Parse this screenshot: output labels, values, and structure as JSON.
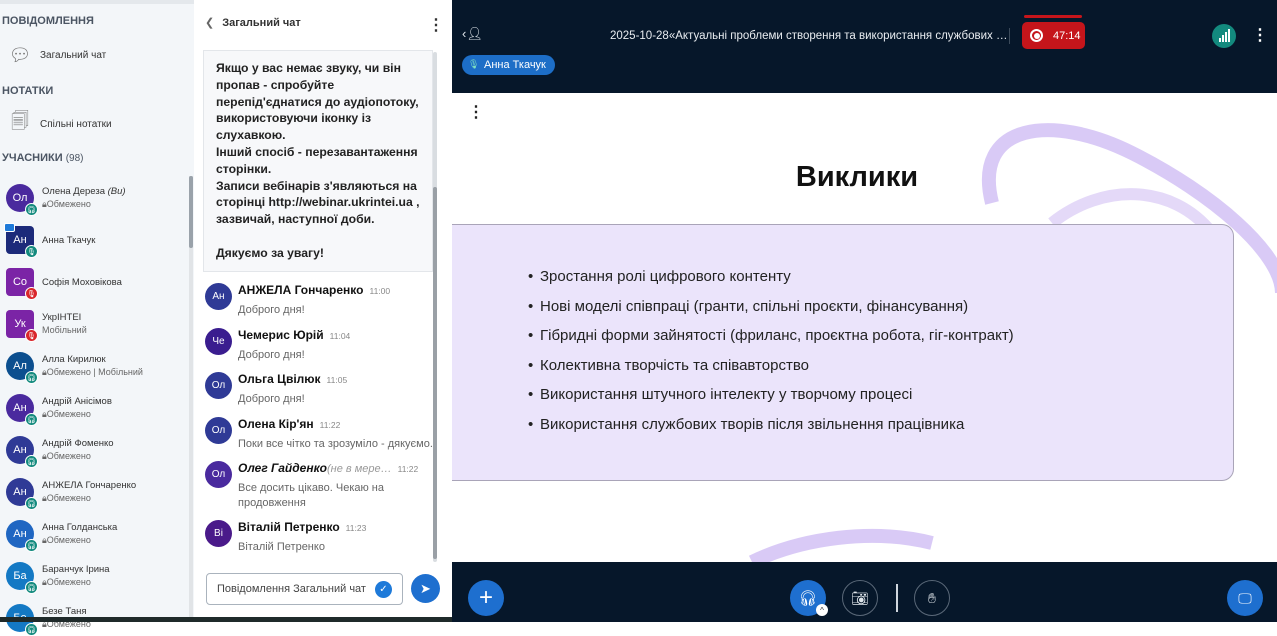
{
  "sidebar": {
    "messages_header": "ПОВІДОМЛЕННЯ",
    "public_chat": "Загальний чат",
    "notes_header": "НОТАТКИ",
    "shared_notes": "Спільні нотатки",
    "users_header": "УЧАСНИКИ",
    "users_count": "(98)",
    "users": [
      {
        "initials": "Ол",
        "name": "Олена Дереза",
        "you": "(Ви)",
        "status": "Обмежено",
        "color": "#4a2a9e",
        "badge": "headset"
      },
      {
        "initials": "Ан",
        "name": "Анна Ткачук",
        "status": "",
        "color": "#1c2a7a",
        "badge": "mic",
        "presenter": true
      },
      {
        "initials": "Со",
        "name": "Софія Моховікова",
        "status": "",
        "color": "#7b24a6",
        "badge": "muted"
      },
      {
        "initials": "Ук",
        "name": "УкрІНТЕІ",
        "status": "Мобільний",
        "color": "#7b24a6",
        "badge": "muted"
      },
      {
        "initials": "Ал",
        "name": "Алла Кирилюк",
        "status": "Обмежено | Мобільний",
        "color": "#0c4f8f",
        "badge": "headset"
      },
      {
        "initials": "Ан",
        "name": "Андрій Анісімов",
        "status": "Обмежено",
        "color": "#4a2a9e",
        "badge": "headset"
      },
      {
        "initials": "Ан",
        "name": "Андрій Фоменко",
        "status": "Обмежено",
        "color": "#2f3a96",
        "badge": "headset"
      },
      {
        "initials": "Ан",
        "name": "АНЖЕЛА Гончаренко",
        "status": "Обмежено",
        "color": "#2f3a96",
        "badge": "headset"
      },
      {
        "initials": "Ан",
        "name": "Анна Голданська",
        "status": "Обмежено",
        "color": "#1f66c2",
        "badge": "headset"
      },
      {
        "initials": "Ба",
        "name": "Баранчук Ірина",
        "status": "Обмежено",
        "color": "#1479c4",
        "badge": "headset"
      },
      {
        "initials": "Бе",
        "name": "Безе Таня",
        "status": "Обмежено",
        "color": "#1479c4",
        "badge": "headset"
      }
    ]
  },
  "chat": {
    "title": "Загальний чат",
    "welcome": "Якщо у вас немає звуку, чи він пропав - спробуйте перепід'єднатися до аудіопотоку, використовуючи іконку із слухавкою.\nІнший спосіб - перезавантаження сторінки.\nЗаписи вебінарів з'являються на сторінці http://webinar.ukrintei.ua , зазвичай, наступної доби.\n\nДякуємо за увагу!",
    "messages": [
      {
        "initials": "Ан",
        "name": "АНЖЕЛА Гончаренко",
        "time": "11:00",
        "text": "Доброго дня!",
        "color": "#2f3a96"
      },
      {
        "initials": "Че",
        "name": "Чемерис Юрій",
        "time": "11:04",
        "text": "Доброго дня!",
        "color": "#3a1d8f"
      },
      {
        "initials": "Ол",
        "name": "Ольга Цвілюк",
        "time": "11:05",
        "text": "Доброго дня!",
        "color": "#2f3a96"
      },
      {
        "initials": "Ол",
        "name": "Олена Кір'ян",
        "time": "11:22",
        "text": "Поки все чітко та зрозуміло - дякуємо.",
        "color": "#2f3a96"
      },
      {
        "initials": "Ол",
        "name": "Олег Гайденко",
        "offline": "(не в мере…",
        "time": "11:22",
        "text": "Все досить цікаво. Чекаю на продовження",
        "color": "#4a2a9e"
      },
      {
        "initials": "Ві",
        "name": "Віталій Петренко",
        "time": "11:23",
        "text": "Віталій Петренко",
        "color": "#4a1a8a"
      }
    ],
    "input_placeholder": "Повідомлення Загальний чат"
  },
  "header": {
    "meeting_title": "2025-10-28«Актуальні проблеми створення та використання службових …",
    "recording_time": "47:14",
    "talking_user": "Анна Ткачук"
  },
  "slide": {
    "title": "Виклики",
    "bullets": [
      "Зростання ролі цифрового контенту",
      "Нові моделі співпраці (гранти, спільні проєкти, фінансування)",
      "Гібридні форми зайнятості (фриланс, проєктна робота, гіг-контракт)",
      "Колективна творчість та співавторство",
      "Використання штучного інтелекту у творчому процесі",
      "Використання службових творів після звільнення працівника"
    ]
  },
  "colors": {
    "accent": "#1e6fcf",
    "recording": "#c5151b",
    "background": "#06172a",
    "slide_box": "#ebe4fb"
  }
}
